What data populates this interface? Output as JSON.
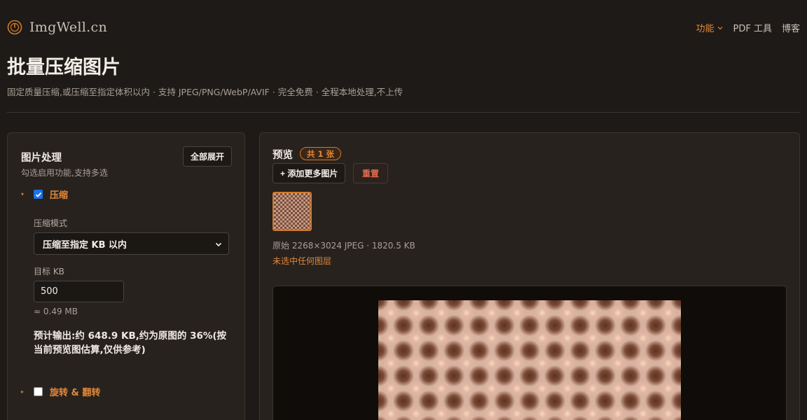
{
  "brand": {
    "name": "ImgWell.cn"
  },
  "nav": {
    "items": [
      {
        "label": "功能",
        "active": true,
        "has_dropdown": true
      },
      {
        "label": "PDF 工具",
        "active": false
      },
      {
        "label": "博客",
        "active": false
      }
    ]
  },
  "page": {
    "title": "批量压缩图片",
    "subtitle": "固定质量压缩,或压缩至指定体积以内 · 支持 JPEG/PNG/WebP/AVIF · 完全免费 · 全程本地处理,不上传"
  },
  "left_panel": {
    "title": "图片处理",
    "subtitle": "勾选启用功能,支持多选",
    "expand_all_label": "全部展开",
    "sections": [
      {
        "label": "压缩",
        "checked": true,
        "expanded": true
      },
      {
        "label": "旋转 & 翻转",
        "checked": false,
        "expanded": false
      }
    ],
    "compress": {
      "mode_label": "压缩模式",
      "mode_value": "压缩至指定 KB 以内",
      "target_label": "目标 KB",
      "target_value": "500",
      "mb_hint": "≈ 0.49 MB",
      "estimate": "预计输出:约 648.9 KB,约为原图的 36%(按当前预览图估算,仅供参考)"
    }
  },
  "right_panel": {
    "title": "预览",
    "count_badge": "共 1 张",
    "add_more_label": "+ 添加更多图片",
    "reset_label": "重置",
    "original_info": "原始 2268×3024 JPEG · 1820.5 KB",
    "no_layer_text": "未选中任何图层"
  },
  "colors": {
    "background": "#1e1a17",
    "panel": "#27221e",
    "accent": "#e2883a",
    "danger": "#e06a4e",
    "checkbox_on": "#1a73e8"
  },
  "icons": {
    "logo": "compass-circle-icon",
    "dropdown": "chevron-down-icon",
    "expand_caret": "caret-down-icon",
    "collapsed_caret": "caret-right-icon",
    "checkmark": "check-icon"
  }
}
